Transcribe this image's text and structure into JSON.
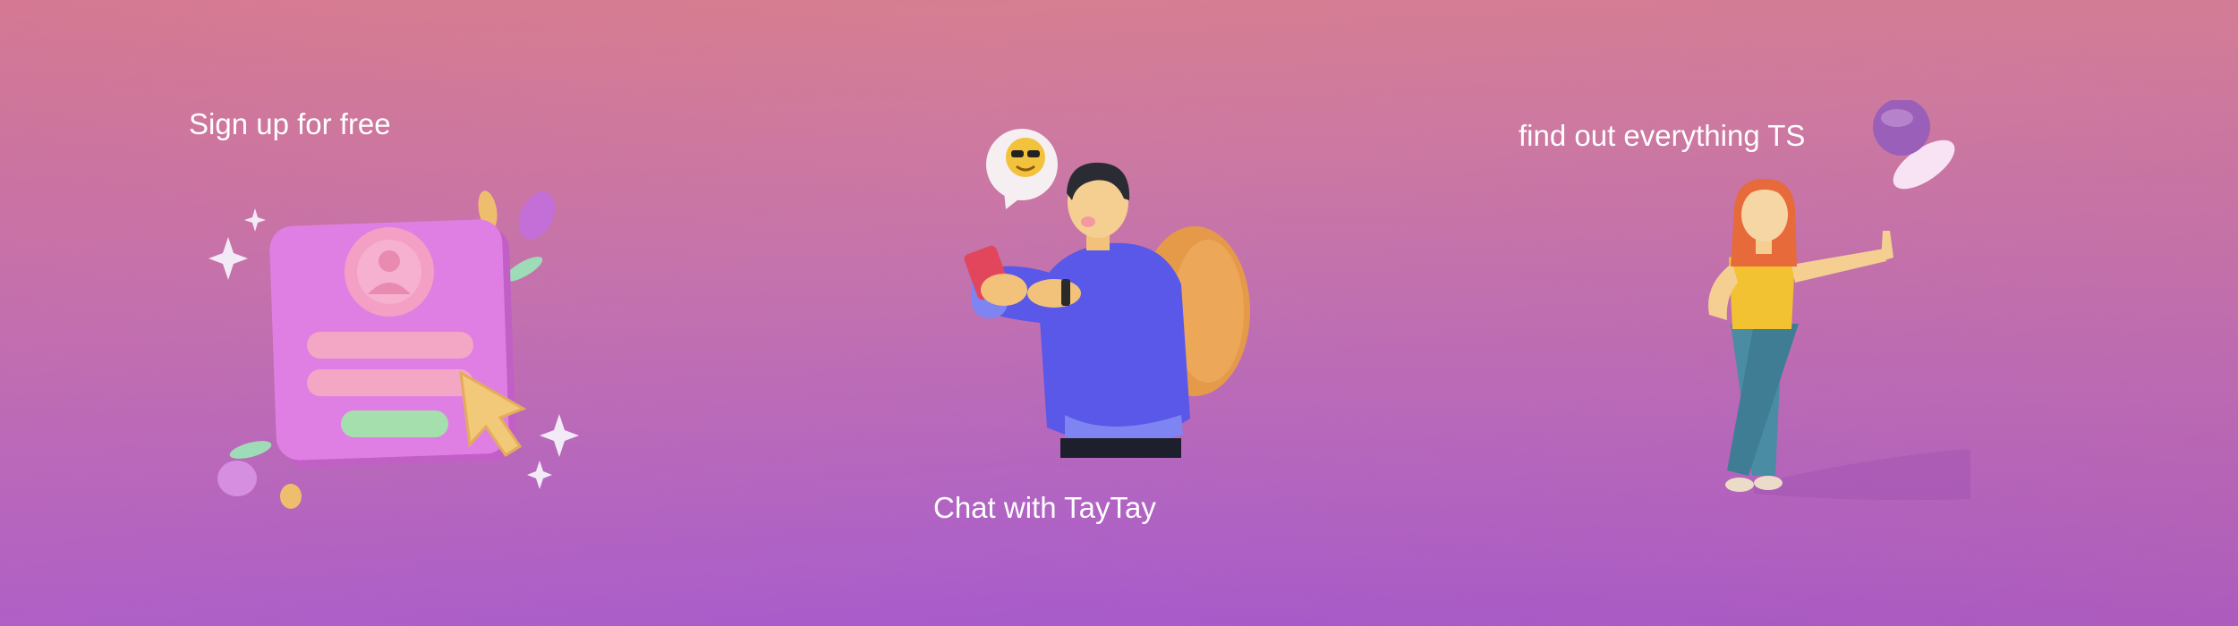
{
  "features": [
    {
      "label": "Sign up for free",
      "illustration": "signup-form-illustration"
    },
    {
      "label": "Chat with TayTay",
      "illustration": "person-chatting-on-phone-illustration"
    },
    {
      "label": "find out everything TS",
      "illustration": "girl-leaning-with-bubble-illustration"
    }
  ],
  "colors": {
    "bg_top": "#e08482",
    "bg_bottom": "#9a4ed6",
    "text": "#ffffff"
  }
}
